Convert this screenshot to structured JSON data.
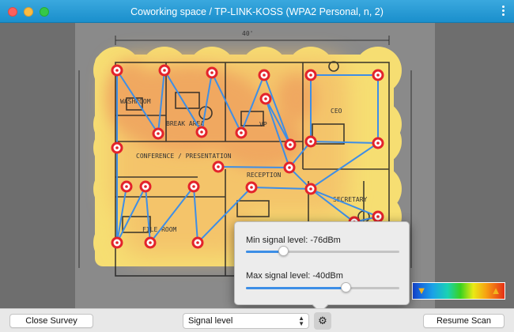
{
  "window": {
    "title": "Coworking space / TP-LINK-KOSS (WPA2 Personal, n, 2)"
  },
  "icons": {
    "close": "window-close",
    "minimize": "window-minimize",
    "maximize": "window-maximize",
    "menu": "kebab-menu-icon",
    "settings": "gear-icon",
    "legend_low": "thumbs-down-icon",
    "legend_high": "thumbs-up-icon"
  },
  "floorplan": {
    "labels": {
      "washroom": "WASHROOM",
      "break_area": "BREAK AREA",
      "vp": "VP",
      "ceo": "CEO",
      "conference": "CONFERENCE / PRESENTATION",
      "reception": "RECEPTION",
      "secretary": "SECRETARY",
      "file_room": "FILE ROOM",
      "dimension": "40'"
    },
    "heatmap_colors": {
      "strong": "#f0a860",
      "medium": "#f4c46a",
      "weak": "#f6de72"
    },
    "point_color": "#e3232b",
    "path_color": "#3e8ee6"
  },
  "toolbar": {
    "close_survey": "Close Survey",
    "view_select": "Signal level",
    "resume_scan": "Resume Scan"
  },
  "popover": {
    "min_label": "Min signal level: -76dBm",
    "max_label": "Max signal level: -40dBm",
    "min_value_fraction": 0.24,
    "max_value_fraction": 0.65
  },
  "legend": {
    "colors": [
      "#1546d8",
      "#1aa3e6",
      "#1ad2b4",
      "#39d21f",
      "#e9ea15",
      "#f7a112",
      "#e53017"
    ]
  }
}
